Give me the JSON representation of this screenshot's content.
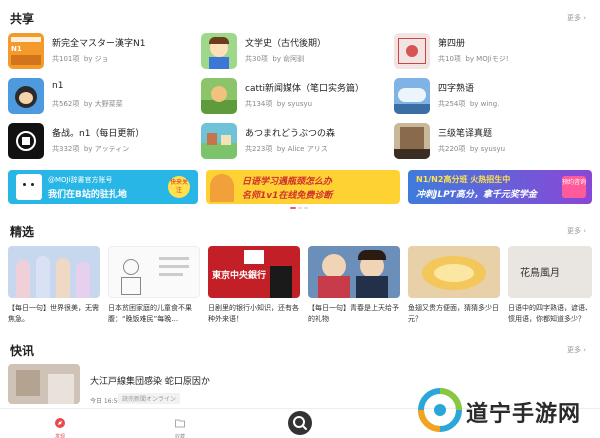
{
  "shared": {
    "title": "共享",
    "more": "更多 ›",
    "items": [
      {
        "title": "新完全マスター漢字N1",
        "count": "共101项",
        "by": "by ジョ"
      },
      {
        "title": "文学史（古代後期）",
        "count": "共30项",
        "by": "by 俞阿驯"
      },
      {
        "title": "第四册",
        "count": "共10项",
        "by": "by MOJiモジ!"
      },
      {
        "title": "n1",
        "count": "共562项",
        "by": "by 大野菜菜"
      },
      {
        "title": "catti新闻媒体（笔口实务篇）",
        "count": "共134项",
        "by": "by syusyu"
      },
      {
        "title": "四字熟语",
        "count": "共254项",
        "by": "by wing."
      },
      {
        "title": "备战。n1（每日更新）",
        "count": "共332项",
        "by": "by アッティン"
      },
      {
        "title": "あつまれどうぶつの森",
        "count": "共223项",
        "by": "by Alice アリス"
      },
      {
        "title": "三级笔译真题",
        "count": "共220项",
        "by": "by syusyu"
      }
    ]
  },
  "banners": [
    {
      "tag": "@MOJi辞書官方账号",
      "text": "我们在B站的驻扎地",
      "badge": "快来关注"
    },
    {
      "line1": "日语学习遇瓶颈怎么办",
      "line2": "名师1v1在线免费诊断"
    },
    {
      "line1": "N1/N2高分班 火热招生中",
      "line2": "冲刺JLPT高分，拿千元奖学金",
      "badge": "预约咨询"
    }
  ],
  "featured": {
    "title": "精选",
    "more": "更多 ›",
    "items": [
      {
        "caption": "【每日一句】世界很美，无需焦急。"
      },
      {
        "caption": "日本贫困家庭的儿童食不果腹：“晚饭难民”每晚…"
      },
      {
        "caption": "日剧里的银行小知识，还有各种外来语！",
        "img_text": "東京中央銀行"
      },
      {
        "caption": "【每日一句】青春是上天给予的礼物"
      },
      {
        "caption": "鱼翅又贵方便面，猜猜多少日元？"
      },
      {
        "caption": "日语中的四字熟语，谚语、惯用语，你都知道多少？",
        "img_text": "花鳥風月"
      }
    ]
  },
  "news": {
    "title": "快讯",
    "more": "更多 ›",
    "item": {
      "title": "大江戸線集団感染 蛇口原因か",
      "time": "今日 16:50",
      "source": "読売新聞オンライン"
    }
  },
  "tabs": [
    {
      "label": "发现"
    },
    {
      "label": "收藏"
    }
  ],
  "watermark": {
    "text": "道宁手游网"
  },
  "colors": {
    "accent": "#e94b4b",
    "bili": "#27b6e6",
    "banner_yellow": "#ffd233",
    "banner_purple": "#7b4dd8"
  }
}
